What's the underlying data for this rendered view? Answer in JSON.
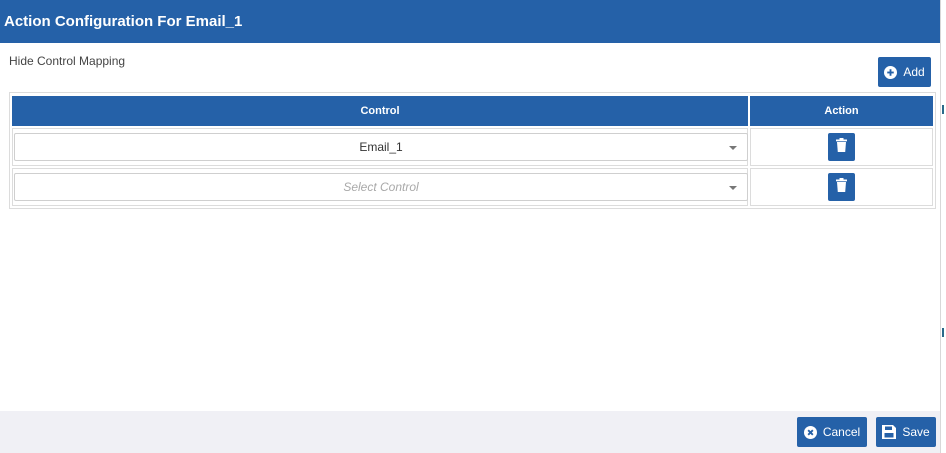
{
  "dialog": {
    "title": "Action Configuration For Email_1",
    "section_label": "Hide Control Mapping"
  },
  "toolbar": {
    "add_label": "Add",
    "add_icon": "plus-circle-icon"
  },
  "table": {
    "columns": [
      "Control",
      "Action"
    ],
    "rows": [
      {
        "control_value": "Email_1",
        "action_icon": "trash-icon"
      },
      {
        "control_placeholder": "Select Control",
        "action_icon": "trash-icon"
      }
    ]
  },
  "footer": {
    "cancel_label": "Cancel",
    "cancel_icon": "x-circle-icon",
    "save_label": "Save",
    "save_icon": "floppy-disk-icon"
  },
  "colors": {
    "primary": "#2561a8",
    "footer_bg": "#f0f0f5"
  }
}
